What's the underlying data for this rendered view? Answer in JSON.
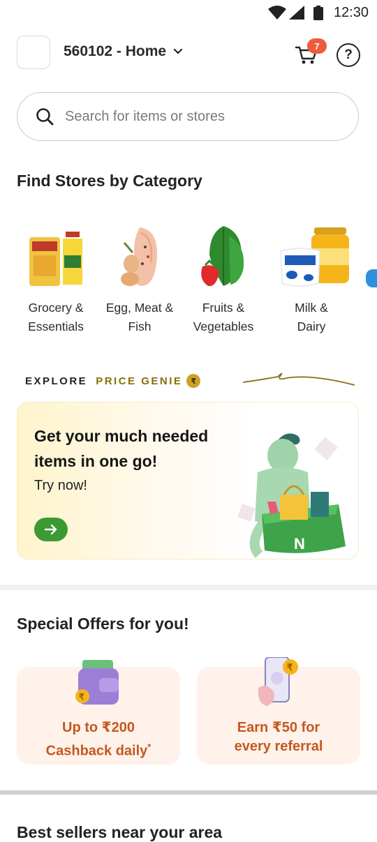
{
  "status_bar": {
    "time": "12:30"
  },
  "header": {
    "location": "560102 - Home",
    "cart_count": "7"
  },
  "search": {
    "placeholder": "Search for items or stores"
  },
  "categories_section": {
    "title": "Find Stores by Category",
    "items": [
      {
        "line1": "Grocery &",
        "line2": "Essentials",
        "icon": "grocery-bag-oil-icon"
      },
      {
        "line1": "Egg, Meat &",
        "line2": "Fish",
        "icon": "chicken-eggs-icon"
      },
      {
        "line1": "Fruits &",
        "line2": "Vegetables",
        "icon": "strawberry-greens-icon"
      },
      {
        "line1": "Milk &",
        "line2": "Dairy",
        "icon": "milk-ghee-icon"
      }
    ]
  },
  "explore": {
    "label": "EXPLORE",
    "brand": "PRICE GENIE",
    "badge": "₹"
  },
  "promo": {
    "title": "Get your much needed items in one go!",
    "subtitle": "Try now!",
    "basket_letter": "N"
  },
  "offers_section": {
    "title": "Special Offers for you!",
    "items": [
      {
        "line1": "Up to ₹200",
        "line2": "Cashback daily",
        "suffix": "*",
        "icon": "wallet-coin-icon"
      },
      {
        "line1": "Earn ₹50 for",
        "line2": "every referral",
        "suffix": "",
        "icon": "phone-referral-icon"
      }
    ]
  },
  "best_sellers": {
    "title": "Best sellers near your area"
  },
  "colors": {
    "accent_green": "#3c9a34",
    "offer_orange": "#c4581f",
    "badge_red": "#f05a3c",
    "gold": "#8a6d0b"
  }
}
